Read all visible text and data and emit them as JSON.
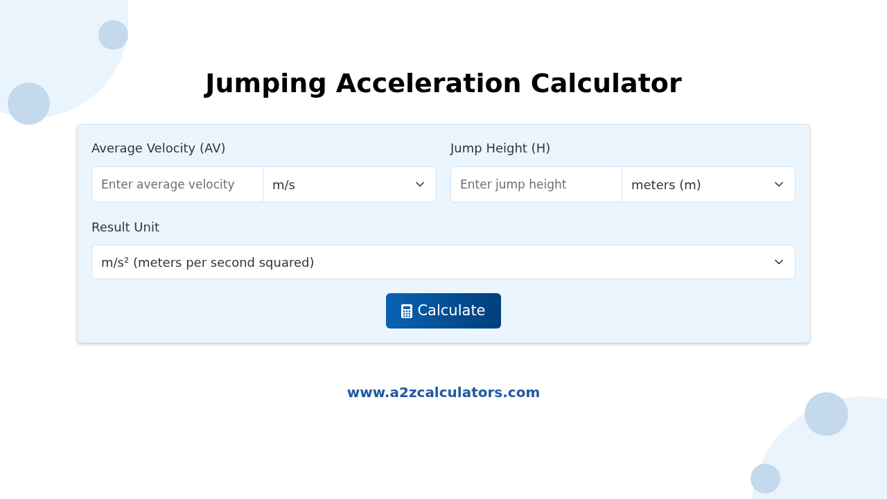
{
  "title": "Jumping Acceleration Calculator",
  "fields": [
    {
      "label": "Average Velocity (AV)",
      "placeholder": "Enter average velocity",
      "unit": "m/s"
    },
    {
      "label": "Jump Height (H)",
      "placeholder": "Enter jump height",
      "unit": "meters (m)"
    }
  ],
  "result_unit": {
    "label": "Result Unit",
    "value": "m/s² (meters per second squared)"
  },
  "button": {
    "label": "Calculate"
  },
  "footer": {
    "link": "www.a2zcalculators.com"
  }
}
